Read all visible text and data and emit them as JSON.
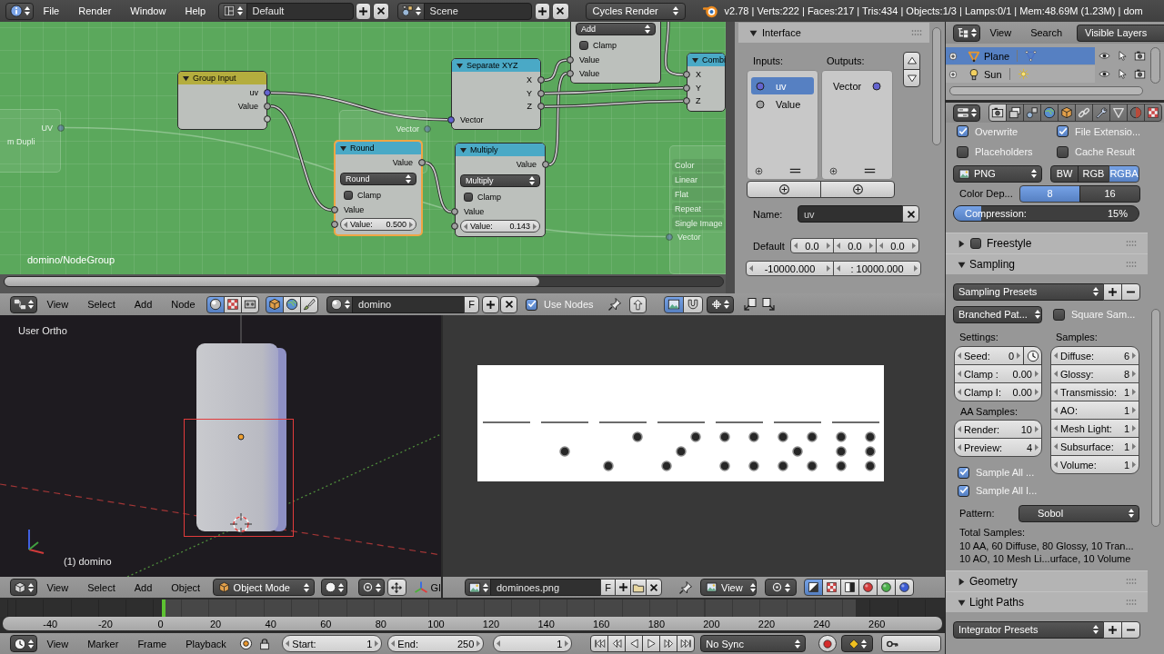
{
  "top_bar": {
    "menus": [
      "File",
      "Render",
      "Window",
      "Help"
    ],
    "screen_layout": "Default",
    "scene": "Scene",
    "render_engine": "Cycles Render",
    "stats": "v2.78 | Verts:222 | Faces:217 | Tris:434 | Objects:1/3 | Lamps:0/1 | Mem:48.69M (1.23M) | dom"
  },
  "node_editor": {
    "nodes": [
      {
        "kind": "group_input",
        "title": "Group Input",
        "selected": false,
        "outputs": [
          {
            "label": "uv",
            "kind": "vector"
          },
          {
            "label": "Value",
            "kind": "value"
          }
        ]
      },
      {
        "kind": "converter",
        "title": "Separate XYZ",
        "selected": false,
        "outputs": [
          {
            "label": "X",
            "kind": "value"
          },
          {
            "label": "Y",
            "kind": "value"
          },
          {
            "label": "Z",
            "kind": "value"
          }
        ],
        "inputs": [
          {
            "label": "Vector",
            "kind": "vector"
          }
        ]
      },
      {
        "kind": "math",
        "selected": false,
        "operation": "Add",
        "clamp": {
          "label": "Clamp",
          "checked": false
        },
        "inputs": [
          {
            "label": "Value",
            "kind": "value"
          },
          {
            "label": "Value",
            "kind": "value"
          }
        ]
      },
      {
        "kind": "converter",
        "title": "Combi",
        "selected": false,
        "inputs": [
          {
            "label": "X",
            "kind": "value"
          },
          {
            "label": "Y",
            "kind": "value"
          },
          {
            "label": "Z",
            "kind": "value"
          }
        ]
      },
      {
        "kind": "math",
        "title": "Round",
        "selected": true,
        "outputs": [
          {
            "label": "Value",
            "kind": "value"
          }
        ],
        "operation": "Round",
        "clamp": {
          "label": "Clamp",
          "checked": false
        },
        "inputs": [
          {
            "label": "Value",
            "kind": "value"
          },
          {
            "label": "Value:",
            "kind": "value",
            "value": "0.500"
          }
        ]
      },
      {
        "kind": "math",
        "title": "Multiply",
        "selected": false,
        "outputs": [
          {
            "label": "Value",
            "kind": "value"
          }
        ],
        "operation": "Multiply",
        "clamp": {
          "label": "Clamp",
          "checked": false
        },
        "inputs": [
          {
            "label": "Value",
            "kind": "value"
          },
          {
            "label": "Value:",
            "kind": "value",
            "value": "0.143"
          }
        ]
      }
    ],
    "inactive_nodes": [
      {
        "items": [
          {
            "label": "UV",
            "kind": "output"
          },
          {
            "label": "m Dupli",
            "kind": "label"
          }
        ]
      },
      {
        "items": [
          {
            "label": "Vector",
            "kind": "output"
          }
        ]
      },
      {
        "items": [
          {
            "label": "Color",
            "kind": "field"
          },
          {
            "label": "Linear",
            "kind": "field"
          },
          {
            "label": "Flat",
            "kind": "field"
          },
          {
            "label": "Repeat",
            "kind": "field"
          },
          {
            "label": "Single Image",
            "kind": "field"
          },
          {
            "label": "Vector",
            "kind": "input"
          }
        ]
      }
    ],
    "breadcrumb": "domino/NodeGroup"
  },
  "sidebar": {
    "panel": {
      "title": "Interface",
      "expanded": true
    },
    "inputs_label": "Inputs:",
    "outputs_label": "Outputs:",
    "inputs": [
      {
        "label": "uv",
        "kind": "vector",
        "selected": true
      },
      {
        "label": "Value",
        "kind": "value",
        "selected": false
      }
    ],
    "outputs": [
      {
        "label": "Vector",
        "kind": "vector",
        "selected": false
      }
    ],
    "name": {
      "label": "Name:",
      "value": "uv"
    },
    "default": {
      "label": "Default",
      "values": [
        "0.0",
        "0.0",
        "0.0"
      ]
    },
    "range": [
      "-10000.000",
      ": 10000.000"
    ]
  },
  "node_header": {
    "menus": [
      "View",
      "Select",
      "Add",
      "Node"
    ],
    "tree_types": [
      {
        "selected": true
      },
      {
        "selected": false
      },
      {
        "selected": false
      }
    ],
    "shader_types": [
      {
        "selected": true
      },
      {
        "selected": false
      },
      {
        "selected": false
      }
    ],
    "material": "domino",
    "fake_user": "F",
    "use_nodes": {
      "label": "Use Nodes",
      "checked": true
    },
    "toggles": [
      {
        "selected": true
      },
      {
        "selected": false
      }
    ]
  },
  "viewport": {
    "view_name": "User Ortho",
    "object_label": "(1) domino"
  },
  "viewport_header": {
    "menus": [
      "View",
      "Select",
      "Add",
      "Object"
    ],
    "mode": "Object Mode",
    "orientation": "Gl"
  },
  "image_header": {
    "image": "dominoes.png",
    "fake_user": "F",
    "mode": "View",
    "channels": [
      {
        "selected": true
      },
      {
        "selected": false
      },
      {
        "selected": false
      },
      {
        "selected": false
      },
      {
        "selected": false
      },
      {
        "selected": false
      }
    ]
  },
  "timeline": {
    "ticks": [
      "-40",
      "-20",
      "0",
      "20",
      "40",
      "60",
      "80",
      "100",
      "120",
      "140",
      "160",
      "180",
      "200",
      "220",
      "240",
      "260"
    ]
  },
  "timeline_header": {
    "menus": [
      "View",
      "Marker",
      "Frame",
      "Playback"
    ],
    "start": {
      "label": "Start:",
      "value": "1"
    },
    "end": {
      "label": "End:",
      "value": "250"
    },
    "current_frame": "1",
    "sync": "No Sync"
  },
  "outliner": {
    "menus": [
      "View",
      "Search"
    ],
    "filter": "Visible Layers",
    "rows": [
      {
        "name": "Plane",
        "kind": "mesh",
        "selected": true,
        "expanded": false
      },
      {
        "name": "Sun",
        "kind": "lamp",
        "selected": false,
        "expanded": false
      }
    ]
  },
  "properties": {
    "tabs": [
      {
        "selected": true
      },
      {
        "selected": false
      },
      {
        "selected": false
      },
      {
        "selected": false
      },
      {
        "selected": false
      },
      {
        "selected": false
      },
      {
        "selected": false
      },
      {
        "selected": false
      },
      {
        "selected": false
      },
      {
        "selected": false
      }
    ],
    "output": {
      "checkboxes": [
        {
          "label": "Overwrite",
          "checked": true
        },
        {
          "label": "File Extensio...",
          "checked": true
        },
        {
          "label": "Placeholders",
          "checked": false
        },
        {
          "label": "Cache Result",
          "checked": false
        }
      ],
      "format": "PNG",
      "color_modes": [
        {
          "label": "BW",
          "selected": false
        },
        {
          "label": "RGB",
          "selected": false
        },
        {
          "label": "RGBA",
          "selected": true
        }
      ],
      "color_depth": {
        "label": "Color Dep...",
        "options": [
          {
            "label": "8",
            "selected": true
          },
          {
            "label": "16",
            "selected": false
          }
        ]
      },
      "compression": {
        "label": "Compression:",
        "reading": "15%",
        "level": 0.15
      }
    },
    "panels": [
      {
        "title": "Freestyle",
        "expanded": false,
        "checked": false
      },
      {
        "title": "Sampling",
        "expanded": true,
        "presets": "Sampling Presets",
        "integrator": "Branched Pat...",
        "square_samples": {
          "label": "Square Sam...",
          "checked": false
        },
        "settings_label": "Settings:",
        "settings": [
          {
            "label": "Seed:",
            "value": "0"
          },
          {
            "label": "Clamp :",
            "value": "0.00"
          },
          {
            "label": "Clamp I:",
            "value": "0.00"
          }
        ],
        "aa_label": "AA Samples:",
        "aa": [
          {
            "label": "Render:",
            "value": "10"
          },
          {
            "label": "Preview:",
            "value": "4"
          }
        ],
        "options": [
          {
            "label": "Sample All ...",
            "checked": true
          },
          {
            "label": "Sample All I...",
            "checked": true
          }
        ],
        "samples_label": "Samples:",
        "samples": [
          {
            "label": "Diffuse:",
            "value": "6"
          },
          {
            "label": "Glossy:",
            "value": "8"
          },
          {
            "label": "Transmissio:",
            "value": "1"
          },
          {
            "label": "AO:",
            "value": "1"
          },
          {
            "label": "Mesh Light:",
            "value": "1"
          },
          {
            "label": "Subsurface:",
            "value": "1"
          },
          {
            "label": "Volume:",
            "value": "1"
          }
        ],
        "pattern": {
          "label": "Pattern:",
          "value": "Sobol"
        },
        "total_label": "Total Samples:",
        "total_lines": [
          "10 AA, 60 Diffuse, 80 Glossy, 10 Tran...",
          "10 AO, 10 Mesh Li...urface, 10 Volume"
        ]
      },
      {
        "title": "Geometry",
        "expanded": false
      },
      {
        "title": "Light Paths",
        "expanded": true,
        "presets": "Integrator Presets"
      }
    ]
  }
}
